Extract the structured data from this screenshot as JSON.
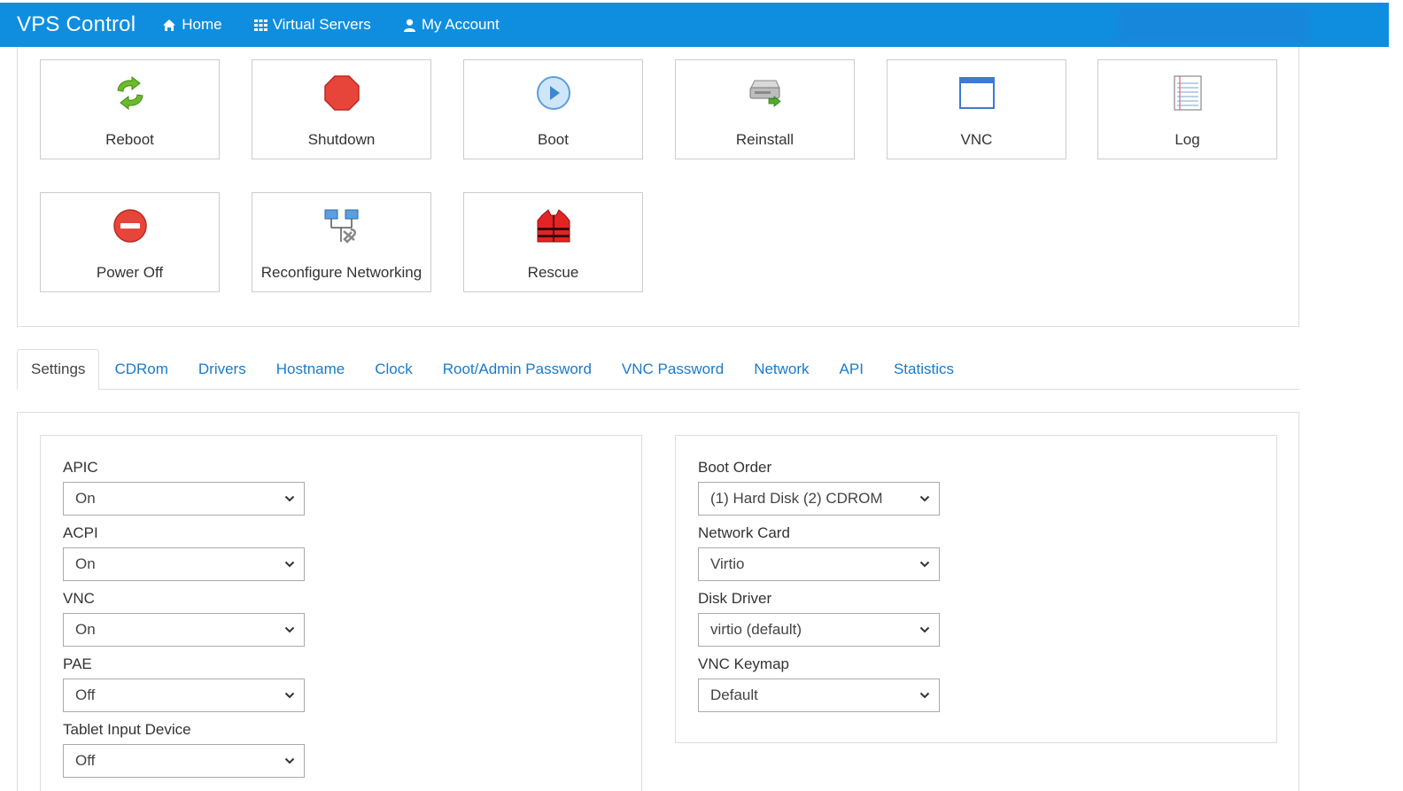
{
  "navbar": {
    "brand": "VPS Control",
    "links": [
      {
        "label": "Home",
        "icon": "home-icon"
      },
      {
        "label": "Virtual Servers",
        "icon": "grid-icon"
      },
      {
        "label": "My Account",
        "icon": "user-icon"
      }
    ]
  },
  "actions": [
    {
      "label": "Reboot",
      "icon": "reboot-icon"
    },
    {
      "label": "Shutdown",
      "icon": "shutdown-icon"
    },
    {
      "label": "Boot",
      "icon": "boot-icon"
    },
    {
      "label": "Reinstall",
      "icon": "reinstall-icon"
    },
    {
      "label": "VNC",
      "icon": "vnc-window-icon"
    },
    {
      "label": "Log",
      "icon": "log-icon"
    },
    {
      "label": "Power Off",
      "icon": "power-off-icon"
    },
    {
      "label": "Reconfigure Networking",
      "icon": "network-config-icon"
    },
    {
      "label": "Rescue",
      "icon": "rescue-vest-icon"
    }
  ],
  "tabs": [
    {
      "label": "Settings",
      "active": true
    },
    {
      "label": "CDRom"
    },
    {
      "label": "Drivers"
    },
    {
      "label": "Hostname"
    },
    {
      "label": "Clock"
    },
    {
      "label": "Root/Admin Password"
    },
    {
      "label": "VNC Password"
    },
    {
      "label": "Network"
    },
    {
      "label": "API"
    },
    {
      "label": "Statistics"
    }
  ],
  "settings": {
    "left": [
      {
        "label": "APIC",
        "value": "On"
      },
      {
        "label": "ACPI",
        "value": "On"
      },
      {
        "label": "VNC",
        "value": "On"
      },
      {
        "label": "PAE",
        "value": "Off"
      },
      {
        "label": "Tablet Input Device",
        "value": "Off"
      }
    ],
    "right": [
      {
        "label": "Boot Order",
        "value": "(1) Hard Disk (2) CDROM"
      },
      {
        "label": "Network Card",
        "value": "Virtio"
      },
      {
        "label": "Disk Driver",
        "value": "virtio (default)"
      },
      {
        "label": "VNC Keymap",
        "value": "Default"
      }
    ]
  },
  "colors": {
    "navbar": "#0f8ee0",
    "link": "#1a7bc9",
    "border": "#dddddd"
  }
}
